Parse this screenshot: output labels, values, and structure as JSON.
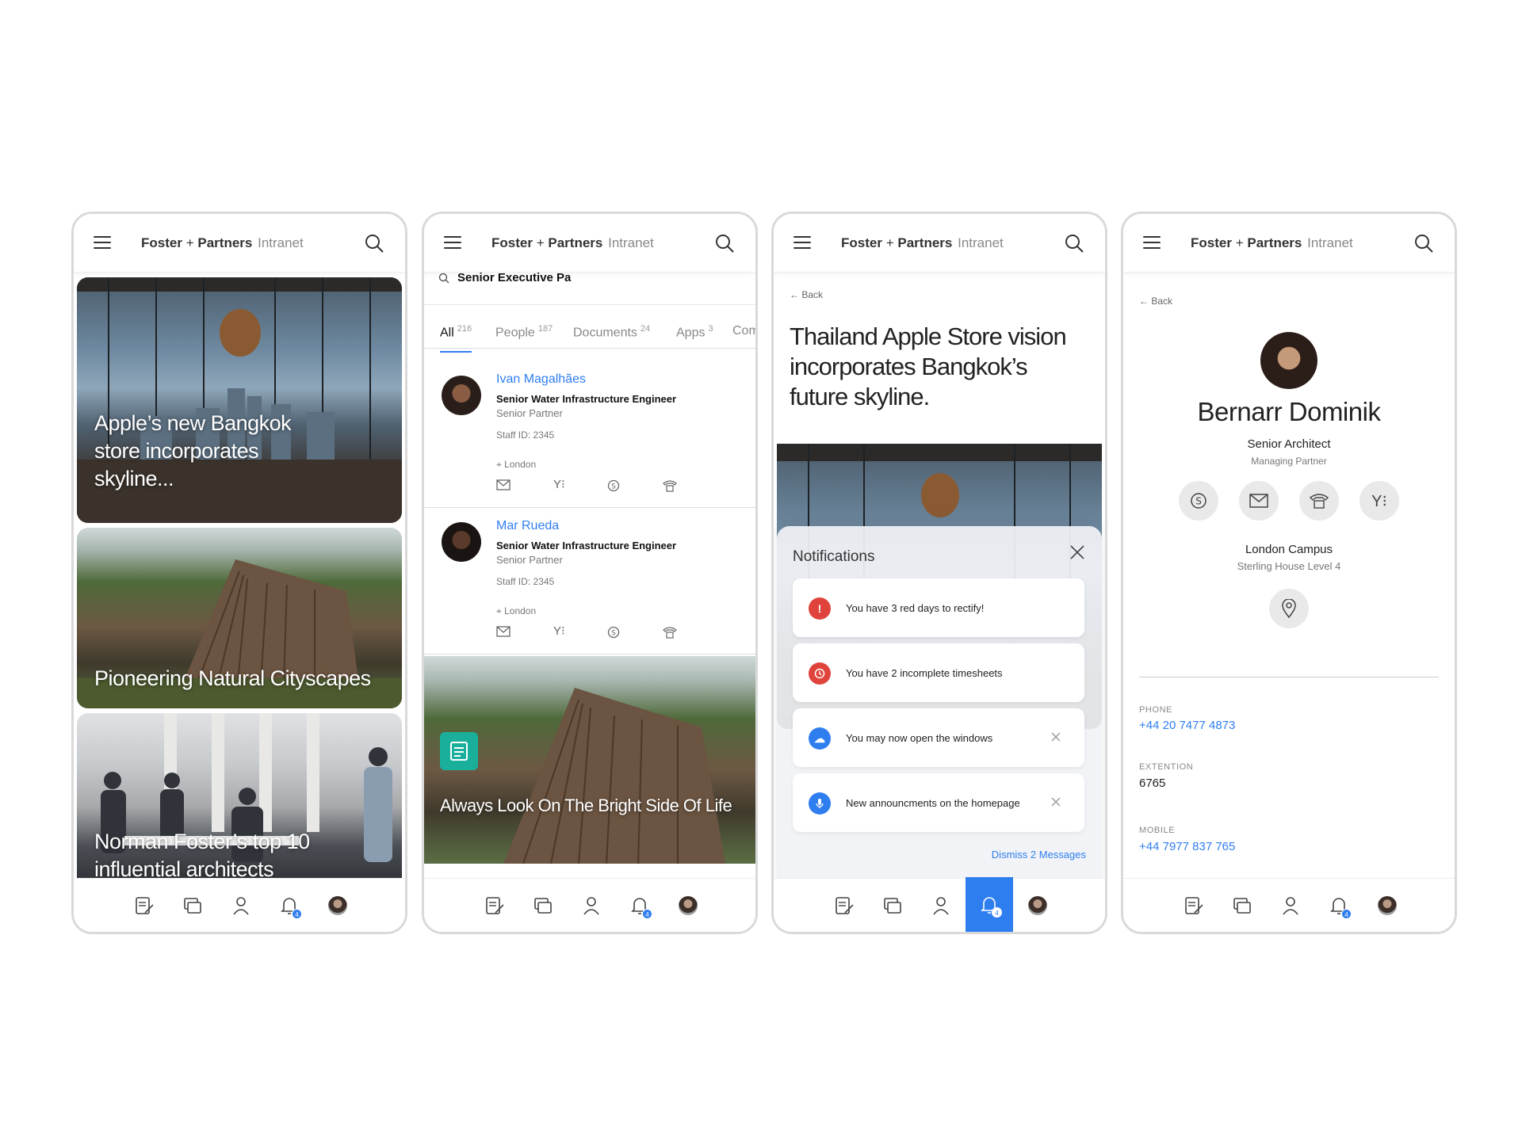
{
  "app": {
    "brand_bold_1": "Foster",
    "brand_plus": "+",
    "brand_bold_2": "Partners",
    "brand_light": "Intranet",
    "accent": "#2f7ef0"
  },
  "nav": {
    "items": [
      "news-icon",
      "documents-icon",
      "people-icon",
      "notifications-icon",
      "profile-avatar"
    ],
    "badge": "4"
  },
  "screen1": {
    "cards": [
      {
        "title": "Apple’s new Bangkok store incorporates skyline..."
      },
      {
        "title": "Pioneering Natural Cityscapes"
      },
      {
        "title": "Norman Foster’s top 10 influential architects"
      }
    ]
  },
  "screen2": {
    "search_value": "Senior Executive Pa",
    "tabs": [
      {
        "label": "All",
        "count": "216"
      },
      {
        "label": "People",
        "count": "187"
      },
      {
        "label": "Documents",
        "count": "24"
      },
      {
        "label": "Apps",
        "count": "3"
      },
      {
        "label": "Com",
        "count": ""
      }
    ],
    "people": [
      {
        "name": "Ivan Magalhães",
        "role": "Senior Water Infrastructure Engineer",
        "level": "Senior Partner",
        "staff": "Staff ID: 2345",
        "location": "London"
      },
      {
        "name": "Mar Rueda",
        "role": "Senior Water Infrastructure Engineer",
        "level": "Senior Partner",
        "staff": "Staff ID: 2345",
        "location": "London"
      }
    ],
    "doc_card": {
      "title": "Always Look On The Bright Side Of Life"
    }
  },
  "screen3": {
    "back": "Back",
    "title": "Thailand Apple Store vision incorporates Bangkok’s future skyline.",
    "panel_title": "Notifications",
    "notifications": [
      {
        "text": "You have 3 red days to rectify!",
        "color": "#e0433b",
        "icon": "alert-icon"
      },
      {
        "text": "You have 2 incomplete timesheets",
        "color": "#e0433b",
        "icon": "clock-icon"
      },
      {
        "text": "You may now open the windows",
        "color": "#2f7ef0",
        "icon": "weather-icon"
      },
      {
        "text": "New announcments on the homepage",
        "color": "#2f7ef0",
        "icon": "microphone-icon"
      }
    ],
    "dismiss": "Dismiss 2 Messages"
  },
  "screen4": {
    "back": "Back",
    "name": "Bernarr Dominik",
    "role": "Senior Architect",
    "level": "Managing Partner",
    "campus": "London Campus",
    "campus_detail": "Sterling House Level 4",
    "fields": [
      {
        "label": "PHONE",
        "value": "+44 20 7477 4873"
      },
      {
        "label": "EXTENTION",
        "value": "6765"
      },
      {
        "label": "MOBILE",
        "value": "+44 7977 837 765"
      }
    ]
  }
}
